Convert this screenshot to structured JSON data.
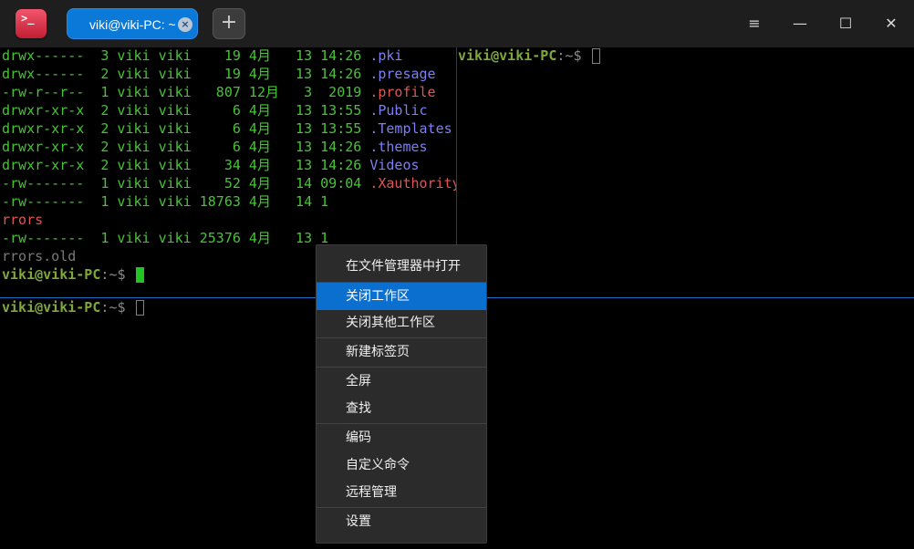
{
  "app": {
    "icon_glyph": ">_"
  },
  "tab": {
    "label": "viki@viki-PC: ~",
    "close_glyph": "×"
  },
  "add_tab": {
    "glyph": "+"
  },
  "window_controls": {
    "menu": "≡",
    "minimize": "—",
    "maximize": "☐",
    "close": "✕"
  },
  "ls_lines": [
    {
      "meta": "drwx------  3 viki viki    19 4月   13 14:26 ",
      "name": ".pki",
      "name_color": "b"
    },
    {
      "meta": "drwx------  2 viki viki    19 4月   13 14:26 ",
      "name": ".presage",
      "name_color": "b"
    },
    {
      "meta": "-rw-r--r--  1 viki viki   807 12月   3  2019 ",
      "name": ".profile",
      "name_color": "r"
    },
    {
      "meta": "drwxr-xr-x  2 viki viki     6 4月   13 13:55 ",
      "name": ".Public",
      "name_color": "b"
    },
    {
      "meta": "drwxr-xr-x  2 viki viki     6 4月   13 13:55 ",
      "name": ".Templates",
      "name_color": "b"
    },
    {
      "meta": "drwxr-xr-x  2 viki viki     6 4月   13 14:26 ",
      "name": ".themes",
      "name_color": "b"
    },
    {
      "meta": "drwxr-xr-x  2 viki viki    34 4月   13 14:26 ",
      "name": "Videos",
      "name_color": "b"
    },
    {
      "meta": "-rw-------  1 viki viki    52 4月   14 09:04 ",
      "name": ".Xauthority",
      "name_color": "r"
    },
    {
      "meta": "-rw-------  1 viki viki 18763 4月   14 1",
      "name": "",
      "name_color": "r"
    },
    {
      "meta": "",
      "name": "rrors",
      "name_color": "r"
    },
    {
      "meta": "-rw-------  1 viki viki 25376 4月   13 1",
      "name": "",
      "name_color": "gray"
    },
    {
      "meta": "",
      "name": "rrors.old",
      "name_color": "gray"
    }
  ],
  "prompt": {
    "user": "viki@viki-PC",
    "sep": ":",
    "path": "~",
    "symbol": "$"
  },
  "context_menu": {
    "items": [
      {
        "label": "在文件管理器中打开"
      },
      {
        "label": "关闭工作区",
        "active": true
      },
      {
        "label": "关闭其他工作区"
      },
      {
        "label": "新建标签页"
      },
      {
        "label": "全屏"
      },
      {
        "label": "查找"
      },
      {
        "label": "编码"
      },
      {
        "label": "自定义命令"
      },
      {
        "label": "远程管理"
      },
      {
        "label": "设置"
      }
    ]
  },
  "colors": {
    "tab_active": "#0b79d8",
    "menu_highlight": "#0b6fd0",
    "terminal_green": "#48c337",
    "terminal_blue": "#7d7ff2",
    "terminal_red": "#e05555",
    "prompt_user": "#7fa83b",
    "cursor": "#21c421"
  }
}
